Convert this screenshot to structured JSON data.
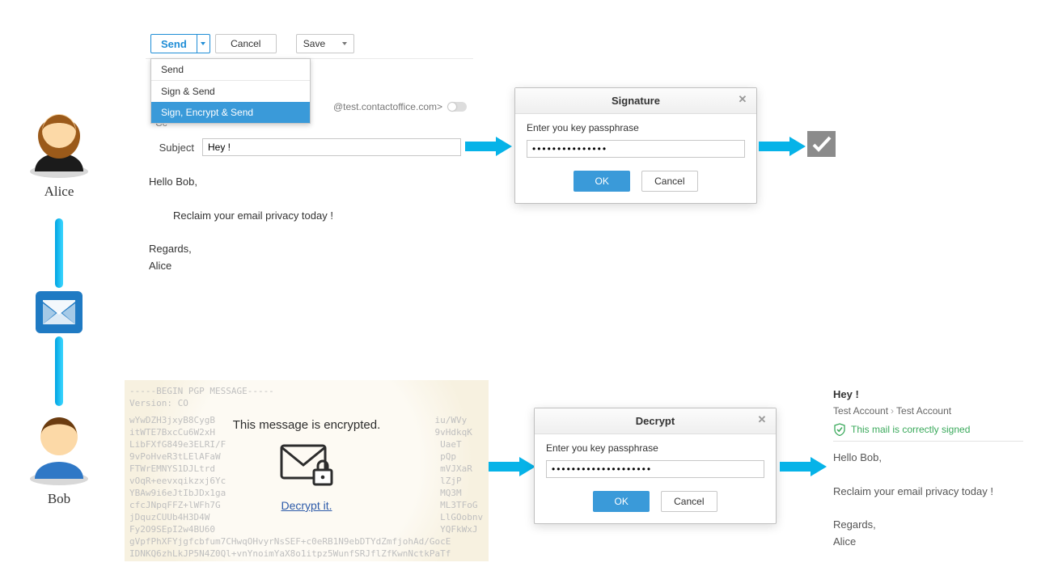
{
  "people": {
    "alice": "Alice",
    "bob": "Bob"
  },
  "compose": {
    "send_label": "Send",
    "cancel_label": "Cancel",
    "save_label": "Save",
    "dropdown": {
      "send": "Send",
      "sign_send": "Sign & Send",
      "sign_encrypt_send": "Sign, Encrypt & Send"
    },
    "to_display": "@test.contactoffice.com>",
    "cc_label": "Cc",
    "subject_label": "Subject",
    "subject_value": "Hey !",
    "body": {
      "greeting": "Hello Bob,",
      "line1": "Reclaim your email privacy today !",
      "regards": "Regards,",
      "name": "Alice"
    }
  },
  "signature_dialog": {
    "title": "Signature",
    "prompt": "Enter you key passphrase",
    "pass_value": "•••••••••••••••",
    "ok": "OK",
    "cancel": "Cancel"
  },
  "pgp_block": {
    "header1": "-----BEGIN PGP MESSAGE-----",
    "header2": "Version: CO",
    "cipher_lines": [
      "wYwDZH3jxyB8CygB                                         iu/WVy",
      "itWTE7BxcCu6W2xH                                         9vHdkqK",
      "LibFXfG849e3ELRI/F                                        UaeT",
      "9vPoHveR3tLElAFaW                                         pQp",
      "FTWrEMNYS1DJLtrd                                          mVJXaR",
      "vOqR+eevxqikzxj6Yc                                        lZjP",
      "YBAw9i6eJtIbJDx1ga                                        MQ3M",
      "cfcJNpqFFZ+lWFh7G                                         ML3TFoG",
      "jDquzCUUb4H3D4W                                           LlGOobnv",
      "Fy2O9SEpI2w4BU60                                          YQFkWxJ",
      "gVpfPhXFYjgfcbfum7CHwqOHvyrNsSEF+c0eRB1N9ebDTYdZmfjohAd/GocE",
      "IDNKQ6zhLkJP5N4Z0Ql+vnYnoimYaX8o1itpz5WunfSRJflZfKwnNctkPaTf"
    ],
    "overlay_message": "This message is encrypted.",
    "decrypt_link": "Decrypt it."
  },
  "decrypt_dialog": {
    "title": "Decrypt",
    "prompt": "Enter you key passphrase",
    "pass_value": "••••••••••••••••••••",
    "ok": "OK",
    "cancel": "Cancel"
  },
  "decrypted_view": {
    "subject": "Hey !",
    "account1": "Test Account",
    "account2": "Test Account",
    "signed_msg": "This mail is correctly signed",
    "body": {
      "greeting": "Hello Bob,",
      "line1": "Reclaim your email privacy today !",
      "regards": "Regards,",
      "name": "Alice"
    }
  }
}
